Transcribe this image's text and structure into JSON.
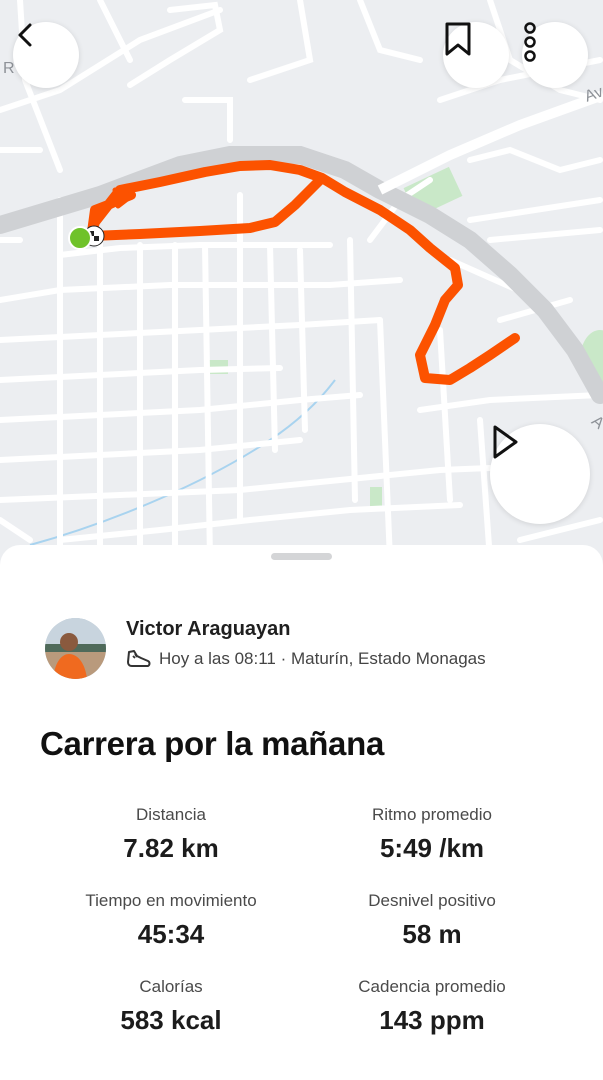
{
  "map": {
    "labels": {
      "left_street": "R",
      "top_avenue": "Av",
      "right_avenue": "A"
    },
    "colors": {
      "route": "#fc5200",
      "start_marker": "#6fc22a",
      "road": "#ffffff",
      "highway": "#cfd1d4",
      "park": "#c9e8c8",
      "water": "#a8d3ef",
      "background": "#eceef1"
    }
  },
  "toolbar": {
    "back_icon": "chevron-left-icon",
    "bookmark_icon": "bookmark-icon",
    "more_icon": "more-vertical-icon",
    "play_icon": "play-icon"
  },
  "athlete": {
    "name": "Victor Araguayan",
    "activity_icon": "running-shoe-icon",
    "meta": "Hoy a las 08:11 · Maturín, Estado Monagas"
  },
  "activity": {
    "title": "Carrera por la mañana"
  },
  "stats": [
    {
      "label": "Distancia",
      "value": "7.82 km"
    },
    {
      "label": "Ritmo promedio",
      "value": "5:49 /km"
    },
    {
      "label": "Tiempo en movimiento",
      "value": "45:34"
    },
    {
      "label": "Desnivel positivo",
      "value": "58 m"
    },
    {
      "label": "Calorías",
      "value": "583 kcal"
    },
    {
      "label": "Cadencia promedio",
      "value": "143 ppm"
    }
  ]
}
